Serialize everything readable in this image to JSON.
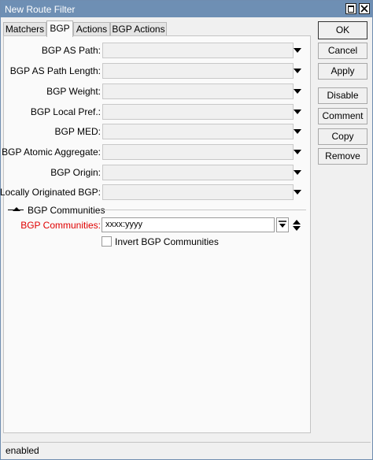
{
  "window": {
    "title": "New Route Filter"
  },
  "tabs": [
    {
      "label": "Matchers"
    },
    {
      "label": "BGP",
      "active": true
    },
    {
      "label": "Actions"
    },
    {
      "label": "BGP Actions"
    }
  ],
  "fields": [
    {
      "label": "BGP AS Path:",
      "value": ""
    },
    {
      "label": "BGP AS Path Length:",
      "value": ""
    },
    {
      "label": "BGP Weight:",
      "value": ""
    },
    {
      "label": "BGP Local Pref.:",
      "value": ""
    },
    {
      "label": "BGP MED:",
      "value": ""
    },
    {
      "label": "BGP Atomic Aggregate:",
      "value": ""
    },
    {
      "label": "BGP Origin:",
      "value": ""
    },
    {
      "label": "Locally Originated BGP:",
      "value": ""
    }
  ],
  "communities": {
    "section_title": "BGP Communities",
    "label": "BGP Communities:",
    "value": "xxxx:yyyy",
    "invert_label": "Invert BGP Communities",
    "invert_checked": false
  },
  "buttons": {
    "ok": "OK",
    "cancel": "Cancel",
    "apply": "Apply",
    "disable": "Disable",
    "comment": "Comment",
    "copy": "Copy",
    "remove": "Remove"
  },
  "status": {
    "text": "enabled"
  },
  "colors": {
    "titlebar": "#6e8fb4",
    "required_label": "#e00000"
  }
}
